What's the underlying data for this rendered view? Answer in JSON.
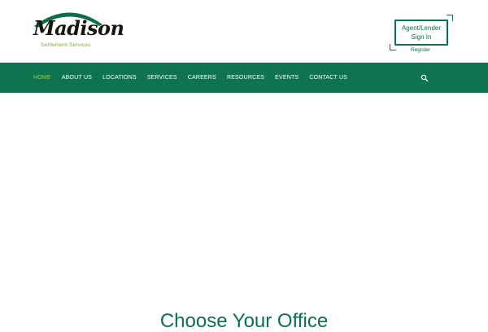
{
  "brand": {
    "name": "Madison",
    "tagline": "Settlement Services",
    "arc_color": "#0e6e4a",
    "tagline_color": "#7aa93a"
  },
  "header": {
    "signin_line1": "Agent/Lender",
    "signin_line2": "Sign In",
    "register_label": "Register"
  },
  "nav": {
    "background": "#0e7450",
    "active_color": "#9ccc4a",
    "items": [
      {
        "label": "HOME",
        "active": true
      },
      {
        "label": "ABOUT US",
        "active": false
      },
      {
        "label": "LOCATIONS",
        "active": false
      },
      {
        "label": "SERVICES",
        "active": false
      },
      {
        "label": "CAREERS",
        "active": false
      },
      {
        "label": "RESOURCES",
        "active": false
      },
      {
        "label": "EVENTS",
        "active": false
      },
      {
        "label": "CONTACT US",
        "active": false
      }
    ],
    "search_icon": "search-icon"
  },
  "main": {
    "section_title": "Choose Your Office"
  }
}
